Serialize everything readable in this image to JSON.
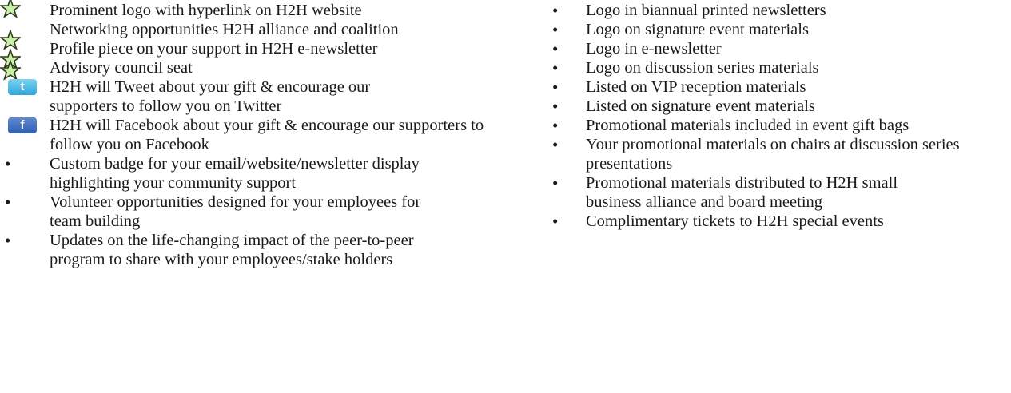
{
  "left": [
    {
      "marker": "star-icon",
      "text": "Prominent logo with hyperlink on H2H website"
    },
    {
      "marker": "star-icon",
      "text": "Networking opportunities H2H alliance and coalition"
    },
    {
      "marker": "star-icon",
      "text": "Profile piece on your support in H2H e-newsletter"
    },
    {
      "marker": "star-icon",
      "text": "Advisory council seat"
    },
    {
      "marker": "twitter-icon",
      "text": "H2H will Tweet about your gift & encourage our supporters to follow you on Twitter"
    },
    {
      "marker": "facebook-icon",
      "text": "H2H will Facebook about your gift & encourage our supporters to follow you on Facebook"
    },
    {
      "marker": "bullet",
      "text": "Custom badge for your email/website/newsletter display highlighting your community support"
    },
    {
      "marker": "bullet",
      "text": "Volunteer opportunities designed for your employees for team building"
    },
    {
      "marker": "bullet",
      "text": "Updates on the life-changing impact of the peer-to-peer program to share with your employees/stake holders"
    }
  ],
  "right": [
    {
      "marker": "bullet",
      "text": "Logo in biannual printed newsletters"
    },
    {
      "marker": "bullet",
      "text": "Logo on signature event materials"
    },
    {
      "marker": "bullet",
      "text": "Logo in e-newsletter"
    },
    {
      "marker": "bullet",
      "text": "Logo on discussion series materials"
    },
    {
      "marker": "bullet",
      "text": "Listed on VIP reception materials"
    },
    {
      "marker": "bullet",
      "text": "Listed on signature event materials"
    },
    {
      "marker": "bullet",
      "text": "Promotional materials included in event gift bags"
    },
    {
      "marker": "bullet",
      "text": "Your promotional materials on chairs at discussion series presentations"
    },
    {
      "marker": "bullet",
      "text": "Promotional materials distributed to H2H small business alliance and board meeting"
    },
    {
      "marker": "bullet",
      "text": "Complimentary tickets to H2H special events"
    }
  ],
  "glyphs": {
    "bullet": "•",
    "twitter": "t",
    "facebook": "f"
  },
  "colors": {
    "star_outline": "#2e3a1f",
    "star_fill": "#c9f0a8",
    "text": "#1a1a1a"
  }
}
